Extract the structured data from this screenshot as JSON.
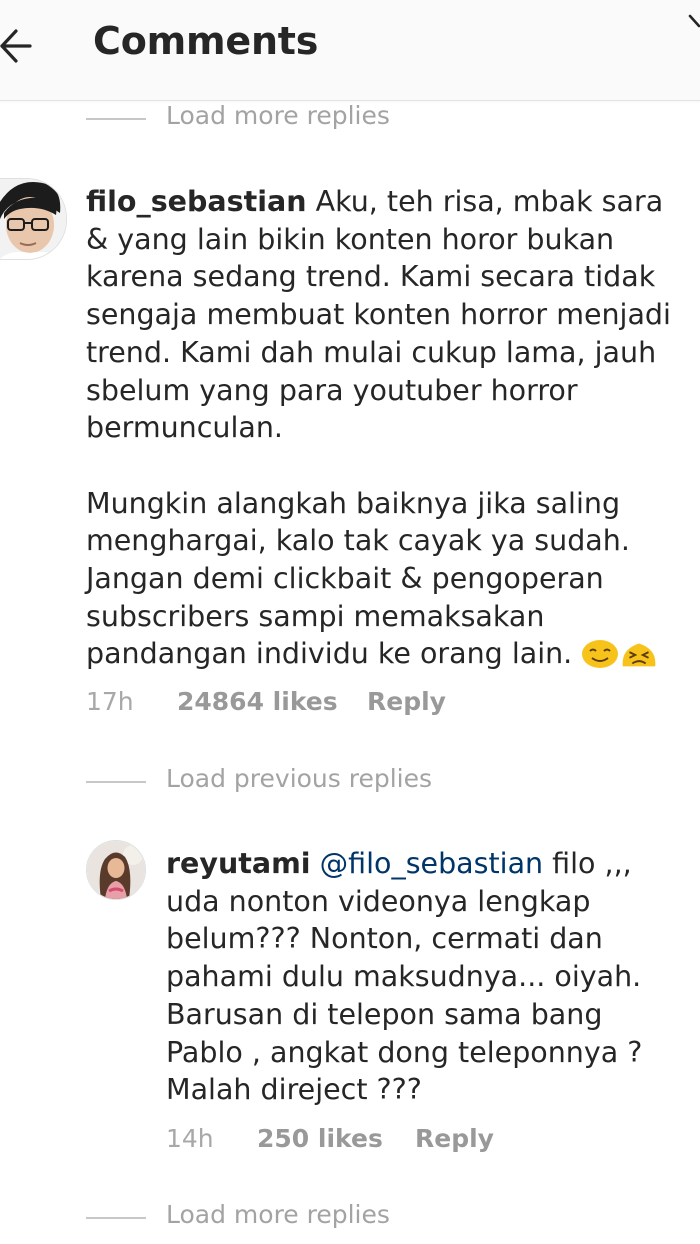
{
  "header": {
    "title": "Comments",
    "back_icon": "arrow-left-icon"
  },
  "load_more_top": "Load more replies",
  "comment": {
    "username": "filo_sebastian",
    "paragraph1": "Aku, teh risa, mbak sara & yang lain bikin konten horor bukan karena sedang trend. Kami secara tidak sengaja membuat konten horror menjadi trend. Kami dah mulai cukup lama, jauh sbelum yang para youtuber horror bermunculan.",
    "paragraph2": "Mungkin alangkah baiknya jika saling menghargai, kalo tak cayak ya sudah. Jangan demi clickbait & pengoperan subscribers sampi memaksakan pandangan individu ke orang lain.",
    "emojis": [
      "smiling-face-emoji",
      "persevering-face-emoji"
    ],
    "time": "17h",
    "likes": "24864 likes",
    "reply": "Reply"
  },
  "load_previous": "Load previous replies",
  "reply_comment": {
    "username": "reyutami",
    "mention": "@filo_sebastian",
    "text": "filo ,,, uda nonton videonya lengkap belum??? Nonton, cermati dan pahami dulu maksudnya... oiyah. Barusan di telepon sama bang Pablo , angkat dong teleponnya ? Malah direject ???",
    "time": "14h",
    "likes": "250 likes",
    "reply": "Reply"
  },
  "load_more_bottom": "Load more replies"
}
